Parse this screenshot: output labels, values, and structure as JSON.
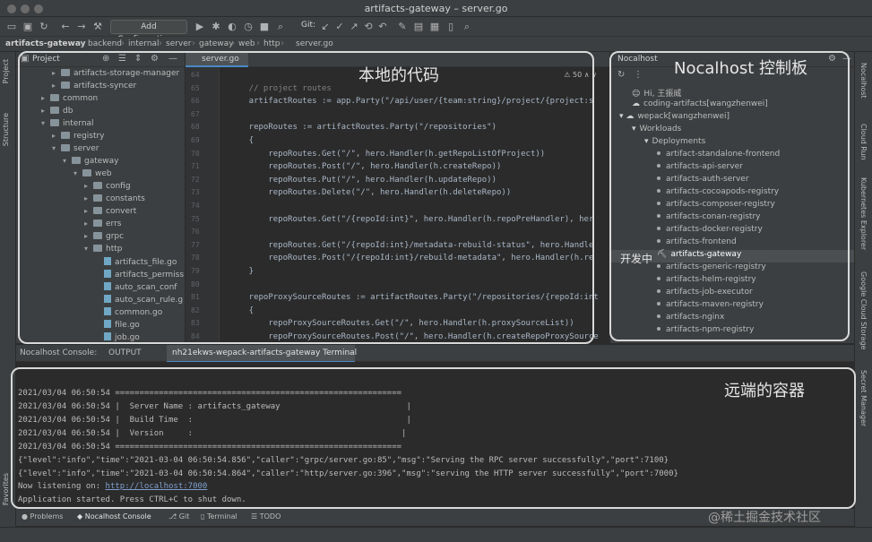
{
  "window": {
    "title": "artifacts-gateway – server.go"
  },
  "toolbar": {
    "add_config_label": "Add Configuration...",
    "git_label": "Git:"
  },
  "breadcrumb": [
    "artifacts-gateway",
    "backend",
    "internal",
    "server",
    "gateway",
    "web",
    "http",
    "server.go"
  ],
  "left_strip": {
    "project_tab": "Project",
    "structure_tab": "Structure",
    "favorites_tab": "Favorites"
  },
  "right_strip": [
    "Nocalhost",
    "Cloud Run",
    "Kubernetes Explorer",
    "Google Cloud Storage",
    "Secret Manager"
  ],
  "project": {
    "title": "Project",
    "tree": [
      {
        "label": "artifacts-storage-manager",
        "kind": "folder",
        "depth": 3,
        "arrow": "▸"
      },
      {
        "label": "artifacts-syncer",
        "kind": "folder",
        "depth": 3,
        "arrow": "▸"
      },
      {
        "label": "common",
        "kind": "folder",
        "depth": 2,
        "arrow": "▸"
      },
      {
        "label": "db",
        "kind": "folder",
        "depth": 2,
        "arrow": "▸"
      },
      {
        "label": "internal",
        "kind": "folder",
        "depth": 2,
        "arrow": "▾"
      },
      {
        "label": "registry",
        "kind": "folder",
        "depth": 3,
        "arrow": "▸"
      },
      {
        "label": "server",
        "kind": "folder",
        "depth": 3,
        "arrow": "▾"
      },
      {
        "label": "gateway",
        "kind": "folder",
        "depth": 4,
        "arrow": "▾"
      },
      {
        "label": "web",
        "kind": "folder",
        "depth": 5,
        "arrow": "▾"
      },
      {
        "label": "config",
        "kind": "folder",
        "depth": 6,
        "arrow": "▸"
      },
      {
        "label": "constants",
        "kind": "folder",
        "depth": 6,
        "arrow": "▸"
      },
      {
        "label": "convert",
        "kind": "folder",
        "depth": 6,
        "arrow": "▸"
      },
      {
        "label": "errs",
        "kind": "folder",
        "depth": 6,
        "arrow": "▸"
      },
      {
        "label": "grpc",
        "kind": "folder",
        "depth": 6,
        "arrow": "▸"
      },
      {
        "label": "http",
        "kind": "folder",
        "depth": 6,
        "arrow": "▾"
      },
      {
        "label": "artifacts_file.go",
        "kind": "file",
        "depth": 7,
        "arrow": ""
      },
      {
        "label": "artifacts_permiss",
        "kind": "file",
        "depth": 7,
        "arrow": ""
      },
      {
        "label": "auto_scan_conf",
        "kind": "file",
        "depth": 7,
        "arrow": ""
      },
      {
        "label": "auto_scan_rule.g",
        "kind": "file",
        "depth": 7,
        "arrow": ""
      },
      {
        "label": "common.go",
        "kind": "file",
        "depth": 7,
        "arrow": ""
      },
      {
        "label": "file.go",
        "kind": "file",
        "depth": 7,
        "arrow": ""
      },
      {
        "label": "job.go",
        "kind": "file",
        "depth": 7,
        "arrow": ""
      }
    ]
  },
  "editor": {
    "tab_label": "server.go",
    "inspect_count": "50",
    "lines": [
      {
        "num": "64",
        "code": ""
      },
      {
        "num": "65",
        "code": "    // project routes"
      },
      {
        "num": "66",
        "code": "    artifactRoutes := app.Party(\"/api/user/{team:string}/project/{project:s"
      },
      {
        "num": "67",
        "code": ""
      },
      {
        "num": "68",
        "code": "    repoRoutes := artifactRoutes.Party(\"/repositories\")"
      },
      {
        "num": "69",
        "code": "    {"
      },
      {
        "num": "70",
        "code": "        repoRoutes.Get(\"/\", hero.Handler(h.getRepoListOfProject))"
      },
      {
        "num": "71",
        "code": "        repoRoutes.Post(\"/\", hero.Handler(h.createRepo))"
      },
      {
        "num": "72",
        "code": "        repoRoutes.Put(\"/\", hero.Handler(h.updateRepo))"
      },
      {
        "num": "73",
        "code": "        repoRoutes.Delete(\"/\", hero.Handler(h.deleteRepo))"
      },
      {
        "num": "74",
        "code": ""
      },
      {
        "num": "75",
        "code": "        repoRoutes.Get(\"/{repoId:int}\", hero.Handler(h.repoPreHandler), her"
      },
      {
        "num": "76",
        "code": ""
      },
      {
        "num": "77",
        "code": "        repoRoutes.Get(\"/{repoId:int}/metadata-rebuild-status\", hero.Handle"
      },
      {
        "num": "78",
        "code": "        repoRoutes.Post(\"/{repoId:int}/rebuild-metadata\", hero.Handler(h.re"
      },
      {
        "num": "79",
        "code": "    }"
      },
      {
        "num": "80",
        "code": ""
      },
      {
        "num": "81",
        "code": "    repoProxySourceRoutes := artifactRoutes.Party(\"/repositories/{repoId:int"
      },
      {
        "num": "82",
        "code": "    {"
      },
      {
        "num": "83",
        "code": "        repoProxySourceRoutes.Get(\"/\", hero.Handler(h.proxySourceList))"
      },
      {
        "num": "84",
        "code": "        repoProxySourceRoutes.Post(\"/\", hero.Handler(h.createRepoProxySource"
      }
    ]
  },
  "nocalhost": {
    "title": "Nocalhost",
    "tree": [
      {
        "label": "Hi, 王振威",
        "depth": 1,
        "prefix": "☺"
      },
      {
        "label": "coding-artifacts[wangzhenwei]",
        "depth": 1,
        "prefix": "☁"
      },
      {
        "label": "wepack[wangzhenwei]",
        "depth": 0,
        "prefix": "▾ ☁"
      },
      {
        "label": "Workloads",
        "depth": 1,
        "prefix": "▾"
      },
      {
        "label": "Deployments",
        "depth": 2,
        "prefix": "▾"
      },
      {
        "label": "artifact-standalone-frontend",
        "depth": 3,
        "prefix": "•"
      },
      {
        "label": "artifacts-api-server",
        "depth": 3,
        "prefix": "•"
      },
      {
        "label": "artifacts-auth-server",
        "depth": 3,
        "prefix": "•"
      },
      {
        "label": "artifacts-cocoapods-registry",
        "depth": 3,
        "prefix": "•"
      },
      {
        "label": "artifacts-composer-registry",
        "depth": 3,
        "prefix": "•"
      },
      {
        "label": "artifacts-conan-registry",
        "depth": 3,
        "prefix": "•"
      },
      {
        "label": "artifacts-docker-registry",
        "depth": 3,
        "prefix": "•"
      },
      {
        "label": "artifacts-frontend",
        "depth": 3,
        "prefix": "•"
      },
      {
        "label": "artifacts-gateway",
        "depth": 3,
        "prefix": "⛏"
      },
      {
        "label": "artifacts-generic-registry",
        "depth": 3,
        "prefix": "•"
      },
      {
        "label": "artifacts-helm-registry",
        "depth": 3,
        "prefix": "•"
      },
      {
        "label": "artifacts-job-executor",
        "depth": 3,
        "prefix": "•"
      },
      {
        "label": "artifacts-maven-registry",
        "depth": 3,
        "prefix": "•"
      },
      {
        "label": "artifacts-nginx",
        "depth": 3,
        "prefix": "•"
      },
      {
        "label": "artifacts-npm-registry",
        "depth": 3,
        "prefix": "•"
      }
    ],
    "developing_label": "开发中"
  },
  "callouts": {
    "local_code": "本地的代码",
    "nocalhost_panel": "Nocalhost 控制板",
    "remote_container": "远端的容器"
  },
  "bottom": {
    "tabs": [
      "Nocalhost Console:",
      "OUTPUT",
      "nh21ekws-wepack-artifacts-gateway Terminal"
    ],
    "console_lines": [
      "2021/03/04 06:50:54 ===========================================================",
      "2021/03/04 06:50:54 |  Server Name : artifacts_gateway                          |",
      "2021/03/04 06:50:54 |  Build Time  :                                            |",
      "2021/03/04 06:50:54 |  Version     :                                           |",
      "2021/03/04 06:50:54 ===========================================================",
      "{\"level\":\"info\",\"time\":\"2021-03-04 06:50:54.856\",\"caller\":\"grpc/server.go:85\",\"msg\":\"Serving the RPC server successfully\",\"port\":7100}",
      "{\"level\":\"info\",\"time\":\"2021-03-04 06:50:54.864\",\"caller\":\"http/server.go:396\",\"msg\":\"serving the HTTP server successfully\",\"port\":7000}"
    ],
    "listening_prefix": "Now listening on: ",
    "listening_url": "http://localhost:7000",
    "started_line": "Application started. Press CTRL+C to shut down."
  },
  "toolwindows": [
    "Problems",
    "Nocalhost Console",
    "Git",
    "Terminal",
    "TODO"
  ],
  "watermark": "@稀土掘金技术社区"
}
